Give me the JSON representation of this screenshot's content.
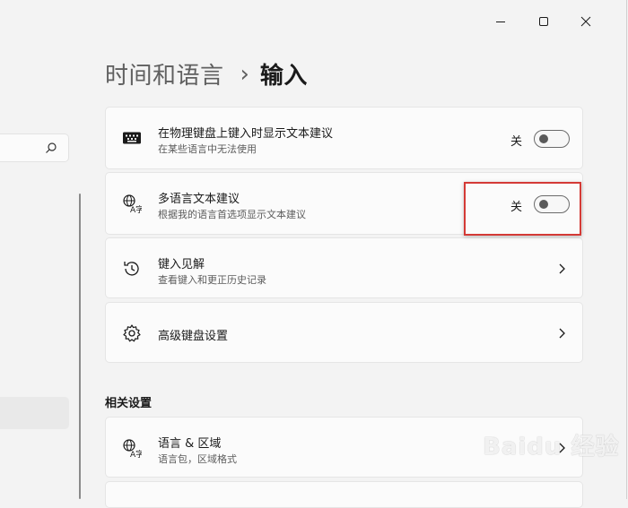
{
  "window": {
    "minimize_icon": "minimize-icon",
    "maximize_icon": "maximize-icon",
    "close_icon": "close-icon"
  },
  "nav": {
    "search_icon": "search-icon"
  },
  "header": {
    "parent": "时间和语言",
    "separator": "›",
    "current": "输入"
  },
  "settings": [
    {
      "icon": "keyboard-icon",
      "title": "在物理键盘上键入时显示文本建议",
      "subtitle": "在某些语言中无法使用",
      "state_label": "关",
      "toggle_on": false
    },
    {
      "icon": "language-icon",
      "title": "多语言文本建议",
      "subtitle": "根据我的语言首选项显示文本建议",
      "state_label": "关",
      "toggle_on": false
    },
    {
      "icon": "history-icon",
      "title": "键入见解",
      "subtitle": "查看键入和更正历史记录"
    },
    {
      "icon": "gear-icon",
      "title": "高级键盘设置"
    }
  ],
  "related": {
    "section_title": "相关设置",
    "items": [
      {
        "icon": "language-icon",
        "title": "语言 & 区域",
        "subtitle": "语言包，区域格式"
      }
    ]
  },
  "watermark": "Baidu 经验",
  "colors": {
    "background": "#f3f3f3",
    "card": "#fbfbfb",
    "highlight": "#d43a36"
  }
}
